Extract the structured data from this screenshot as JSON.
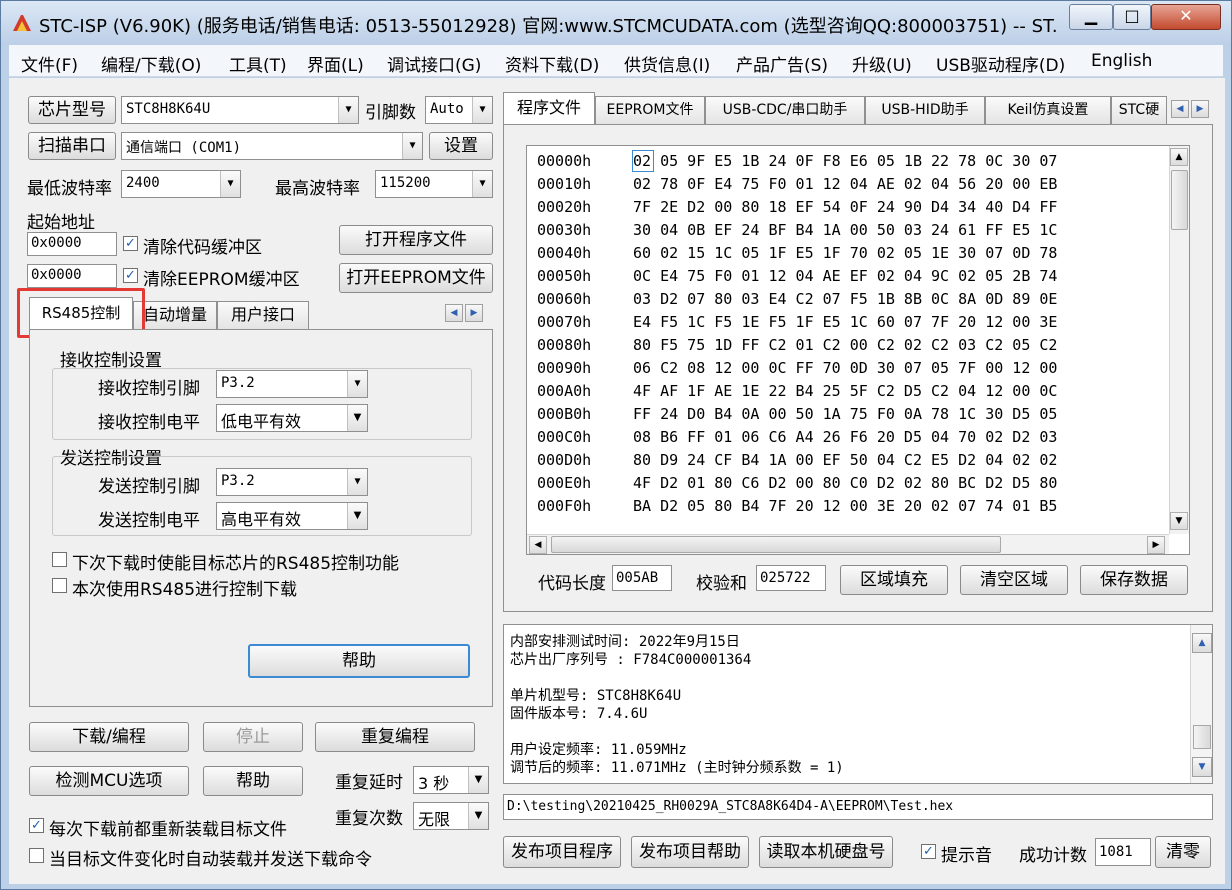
{
  "window": {
    "title": "STC-ISP (V6.90K) (服务电话/销售电话: 0513-55012928) 官网:www.STCMCUDATA.com (选型咨询QQ:800003751) -- ST...",
    "minimize": "▁",
    "maximize": "□",
    "close": "✕"
  },
  "menu": [
    "文件(F)",
    "编程/下载(O)",
    "工具(T)",
    "界面(L)",
    "调试接口(G)",
    "资料下载(D)",
    "供货信息(I)",
    "产品广告(S)",
    "升级(U)",
    "USB驱动程序(D)",
    "English"
  ],
  "left": {
    "chip_type_button": "芯片型号",
    "chip_type_value": "STC8H8K64U",
    "pin_count_label": "引脚数",
    "pin_count_value": "Auto",
    "scan_port_button": "扫描串口",
    "port_value": "通信端口 (COM1)",
    "settings_button": "设置",
    "min_baud_label": "最低波特率",
    "min_baud_value": "2400",
    "max_baud_label": "最高波特率",
    "max_baud_value": "115200",
    "start_addr_label": "起始地址",
    "code_addr_value": "0x0000",
    "clear_code_label": "清除代码缓冲区",
    "eeprom_addr_value": "0x0000",
    "clear_eeprom_label": "清除EEPROM缓冲区",
    "open_program_button": "打开程序文件",
    "open_eeprom_button": "打开EEPROM文件",
    "tabs": [
      "RS485控制",
      "自动增量",
      "用户接口"
    ],
    "receive_group": "接收控制设置",
    "receive_pin_label": "接收控制引脚",
    "receive_pin_value": "P3.2",
    "receive_level_label": "接收控制电平",
    "receive_level_value": "低电平有效",
    "send_group": "发送控制设置",
    "send_pin_label": "发送控制引脚",
    "send_pin_value": "P3.2",
    "send_level_label": "发送控制电平",
    "send_level_value": "高电平有效",
    "enable_rs485_label": "下次下载时使能目标芯片的RS485控制功能",
    "use_rs485_label": "本次使用RS485进行控制下载",
    "help_button": "帮助",
    "download_button": "下载/编程",
    "stop_button": "停止",
    "repeat_button": "重复编程",
    "detect_mcu_button": "检测MCU选项",
    "help2_button": "帮助",
    "repeat_delay_label": "重复延时",
    "repeat_delay_value": "3 秒",
    "repeat_count_label": "重复次数",
    "repeat_count_value": "无限",
    "reload_label": "每次下载前都重新装载目标文件",
    "auto_load_label": "当目标文件变化时自动装载并发送下载命令"
  },
  "right": {
    "tabs": [
      "程序文件",
      "EEPROM文件",
      "USB-CDC/串口助手",
      "USB-HID助手",
      "Keil仿真设置",
      "STC硬"
    ],
    "hex_rows": [
      {
        "addr": "00000h",
        "bytes": "02 05 9F E5 1B 24 0F F8 E6 05 1B 22 78 0C 30 07"
      },
      {
        "addr": "00010h",
        "bytes": "02 78 0F E4 75 F0 01 12 04 AE 02 04 56 20 00 EB"
      },
      {
        "addr": "00020h",
        "bytes": "7F 2E D2 00 80 18 EF 54 0F 24 90 D4 34 40 D4 FF"
      },
      {
        "addr": "00030h",
        "bytes": "30 04 0B EF 24 BF B4 1A 00 50 03 24 61 FF E5 1C"
      },
      {
        "addr": "00040h",
        "bytes": "60 02 15 1C 05 1F E5 1F 70 02 05 1E 30 07 0D 78"
      },
      {
        "addr": "00050h",
        "bytes": "0C E4 75 F0 01 12 04 AE EF 02 04 9C 02 05 2B 74"
      },
      {
        "addr": "00060h",
        "bytes": "03 D2 07 80 03 E4 C2 07 F5 1B 8B 0C 8A 0D 89 0E"
      },
      {
        "addr": "00070h",
        "bytes": "E4 F5 1C F5 1E F5 1F E5 1C 60 07 7F 20 12 00 3E"
      },
      {
        "addr": "00080h",
        "bytes": "80 F5 75 1D FF C2 01 C2 00 C2 02 C2 03 C2 05 C2"
      },
      {
        "addr": "00090h",
        "bytes": "06 C2 08 12 00 0C FF 70 0D 30 07 05 7F 00 12 00"
      },
      {
        "addr": "000A0h",
        "bytes": "4F AF 1F AE 1E 22 B4 25 5F C2 D5 C2 04 12 00 0C"
      },
      {
        "addr": "000B0h",
        "bytes": "FF 24 D0 B4 0A 00 50 1A 75 F0 0A 78 1C 30 D5 05"
      },
      {
        "addr": "000C0h",
        "bytes": "08 B6 FF 01 06 C6 A4 26 F6 20 D5 04 70 02 D2 03"
      },
      {
        "addr": "000D0h",
        "bytes": "80 D9 24 CF B4 1A 00 EF 50 04 C2 E5 D2 04 02 02"
      },
      {
        "addr": "000E0h",
        "bytes": "4F D2 01 80 C6 D2 00 80 C0 D2 02 80 BC D2 D5 80"
      },
      {
        "addr": "000F0h",
        "bytes": "BA D2 05 80 B4 7F 20 12 00 3E 20 02 07 74 01 B5"
      }
    ],
    "code_length_label": "代码长度",
    "code_length_value": "005AB",
    "checksum_label": "校验和",
    "checksum_value": "025722",
    "fill_button": "区域填充",
    "clear_button": "清空区域",
    "save_button": "保存数据",
    "log_lines": [
      "  内部安排测试时间: 2022年9月15日",
      "芯片出厂序列号 : F784C000001364",
      "",
      "  单片机型号: STC8H8K64U",
      "  固件版本号: 7.4.6U",
      "",
      "  用户设定频率: 11.059MHz",
      "  调节后的频率: 11.071MHz (主时钟分频系数 = 1)"
    ],
    "file_path": "D:\\testing\\20210425_RH0029A_STC8A8K64D4-A\\EEPROM\\Test.hex",
    "publish_program_button": "发布项目程序",
    "publish_help_button": "发布项目帮助",
    "read_disk_button": "读取本机硬盘号",
    "beep_label": "提示音",
    "success_count_label": "成功计数",
    "success_count_value": "1081",
    "clear_count_button": "清零"
  },
  "colors": {
    "highlight": "#e53935",
    "selection": "#3d8ad4"
  }
}
